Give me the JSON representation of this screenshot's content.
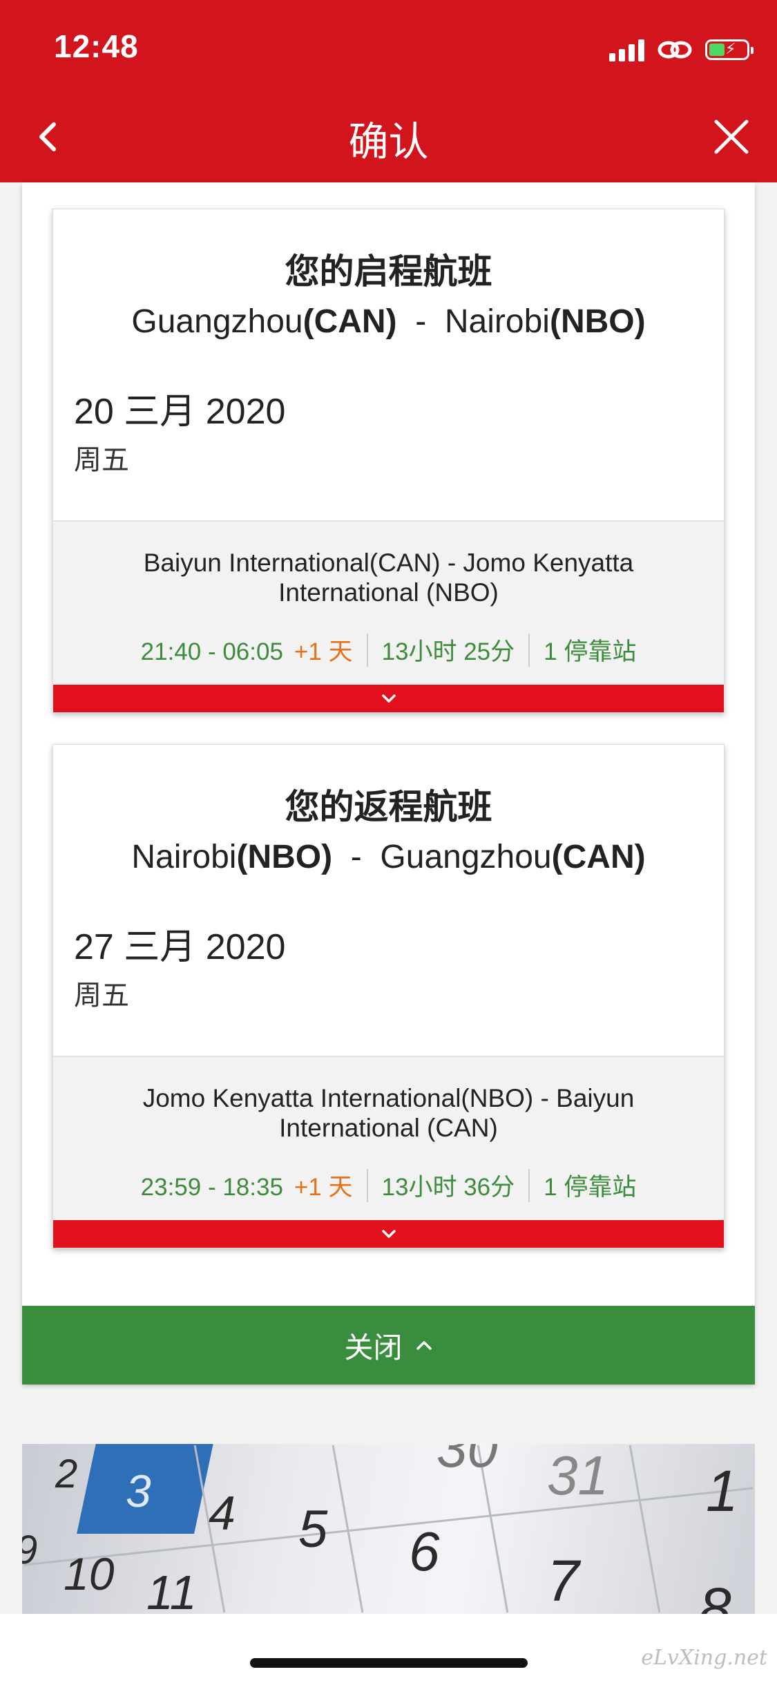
{
  "status_bar": {
    "time": "12:48"
  },
  "header": {
    "title": "确认"
  },
  "flights": [
    {
      "title": "您的启程航班",
      "from_city": "Guangzhou",
      "from_code": "(CAN)",
      "to_city": "Nairobi",
      "to_code": "(NBO)",
      "route_sep": "  -  ",
      "date": "20 三月 2020",
      "weekday": "周五",
      "airports": "Baiyun International(CAN) - Jomo Kenyatta International (NBO)",
      "times": "21:40 - 06:05",
      "next_day": "+1 天",
      "duration": "13小时 25分",
      "stops": "1 停靠站"
    },
    {
      "title": "您的返程航班",
      "from_city": "Nairobi",
      "from_code": "(NBO)",
      "to_city": "Guangzhou",
      "to_code": "(CAN)",
      "route_sep": "  -  ",
      "date": "27 三月 2020",
      "weekday": "周五",
      "airports": "Jomo Kenyatta International(NBO) - Baiyun International (CAN)",
      "times": "23:59 - 18:35",
      "next_day": "+1 天",
      "duration": "13小时 36分",
      "stops": "1 停靠站"
    }
  ],
  "close_section": {
    "label": "关闭"
  },
  "calendar_image": {
    "numbers": [
      "2",
      "3",
      "4",
      "5",
      "6",
      "30",
      "31",
      "1",
      "9",
      "10",
      "11",
      "7",
      "8"
    ]
  },
  "watermark": "eLvXing.net",
  "colors": {
    "brand_red": "#d2141c",
    "green": "#3a8d3c",
    "orange": "#e8701a"
  }
}
